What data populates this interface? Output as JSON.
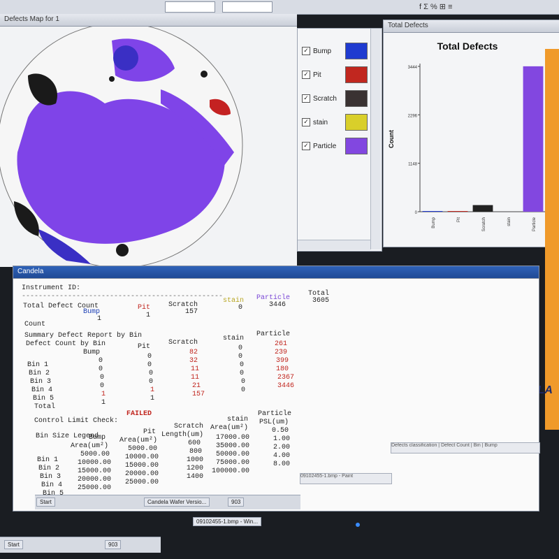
{
  "toolbar": {
    "dropdown1": "",
    "dropdown2": "",
    "symbols": "f Σ % ⊞ ≡"
  },
  "wafer_window": {
    "title": "Defects Map for 1"
  },
  "legend": {
    "items": [
      {
        "label": "Bump",
        "color": "#1f3bd0",
        "checked": true
      },
      {
        "label": "Pit",
        "color": "#c1271f",
        "checked": true
      },
      {
        "label": "Scratch",
        "color": "#3a3232",
        "checked": true
      },
      {
        "label": "stain",
        "color": "#d9cf2a",
        "checked": true
      },
      {
        "label": "Particle",
        "color": "#8247e0",
        "checked": true
      }
    ]
  },
  "chart_window": {
    "title": "Total Defects"
  },
  "chart_data": {
    "type": "bar",
    "title": "Total Defects",
    "ylabel": "Count",
    "xlabel": "",
    "categories": [
      "Bump",
      "Pit",
      "Scratch",
      "stain",
      "Particle"
    ],
    "values": [
      1,
      1,
      157,
      0,
      3446
    ],
    "yticks": [
      0,
      1148,
      2296,
      3444
    ],
    "ylim": [
      0,
      3444
    ],
    "colors": [
      "#1f3bd0",
      "#c1271f",
      "#222222",
      "#d9cf2a",
      "#8247e0"
    ]
  },
  "report": {
    "window_title": "Candela",
    "instrument_id": "Instrument ID:",
    "divider": "------------------------------------------------",
    "total_title": "Total Defect Count",
    "count_label": "Count",
    "headers": {
      "bump": "Bump",
      "pit": "Pit",
      "scratch": "Scratch",
      "stain": "stain",
      "particle": "Particle",
      "total": "Total"
    },
    "totals": {
      "bump": "1",
      "pit": "1",
      "scratch": "157",
      "stain": "0",
      "particle": "3446",
      "total": "3605"
    },
    "summary_title": "Summary Defect Report by Bin",
    "by_bin_title": "Defect Count by Bin",
    "bin_labels": [
      "Bin 1",
      "Bin 2",
      "Bin 3",
      "Bin 4",
      "Bin 5",
      "Total"
    ],
    "bin_rows": [
      [
        "0",
        "0",
        "82",
        "0",
        "261"
      ],
      [
        "0",
        "0",
        "32",
        "0",
        "239"
      ],
      [
        "0",
        "0",
        "11",
        "0",
        "399"
      ],
      [
        "0",
        "0",
        "11",
        "0",
        "180"
      ],
      [
        "1",
        "1",
        "21",
        "0",
        "2367"
      ],
      [
        "1",
        "1",
        "157",
        "0",
        "3446"
      ]
    ],
    "limit_label": "Control Limit Check:",
    "limit_value": "FAILED",
    "legend_title": "Bin Size Legend",
    "legend_headers": {
      "bump": "Bump",
      "bump_unit": "Area(um²)",
      "pit": "Pit",
      "pit_unit": "Area(um²)",
      "scratch": "Scratch",
      "scratch_unit": "Length(um)",
      "stain": "stain",
      "stain_unit": "Area(um²)",
      "particle": "Particle",
      "particle_unit": "PSL(um)"
    },
    "legend_bins": [
      "Bin 1",
      "Bin 2",
      "Bin 3",
      "Bin 4",
      "Bin 5"
    ],
    "legend_rows": [
      [
        "5000.00",
        "5000.00",
        "600",
        "17000.00",
        "0.50"
      ],
      [
        "10000.00",
        "10000.00",
        "800",
        "35000.00",
        "1.00"
      ],
      [
        "15000.00",
        "15000.00",
        "1000",
        "50000.00",
        "2.00"
      ],
      [
        "20000.00",
        "20000.00",
        "1200",
        "75000.00",
        "4.00"
      ],
      [
        "25000.00",
        "25000.00",
        "1400",
        "100000.00",
        "8.00"
      ]
    ]
  },
  "right_panel": {
    "brand": "KLA"
  },
  "status_bar": {
    "text1": "Defects classification | Defect Count | Bin | Bump",
    "text2": "09102455-1.bmp - Paint"
  },
  "taskbar_inner": {
    "start": "Start",
    "task1": "Candela Wafer Versio...",
    "task2": "903"
  },
  "taskbar_outer": {
    "start": "Start",
    "task1": "09102455-1.bmp - Win...",
    "task2": "903"
  }
}
